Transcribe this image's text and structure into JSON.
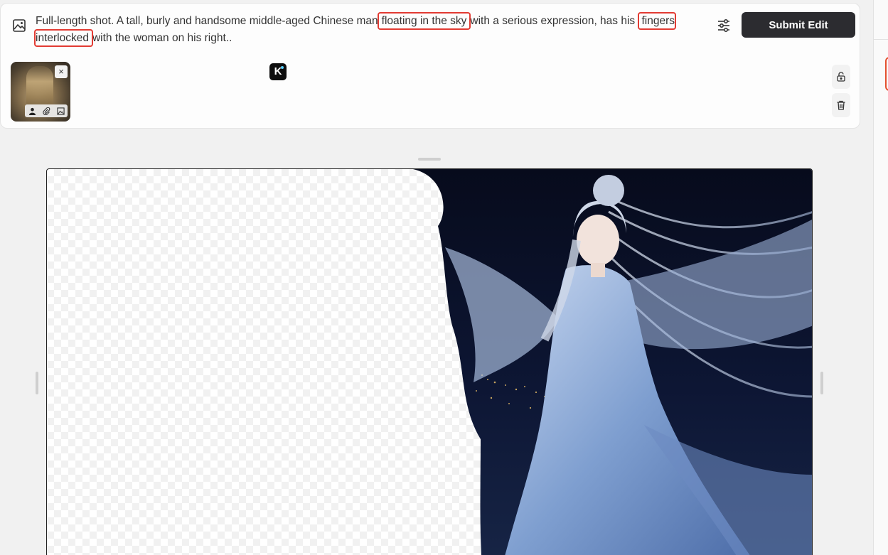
{
  "prompt": {
    "part1": "Full-length shot. A tall, burly and handsome middle-aged Chinese man",
    "highlight1": "floating in the sky",
    "part2": "with a serious expression, has his",
    "highlight2": "fingers interlocked",
    "part3": "with the woman on his right.."
  },
  "toolbar": {
    "submit_label": "Submit Edit",
    "logo_letter": "K"
  },
  "thumbnail": {
    "close_glyph": "×"
  },
  "icons": {
    "image_mode": "image-icon",
    "settings": "sliders-icon",
    "person": "person-icon",
    "attach": "paperclip-icon",
    "image": "image-icon",
    "lock": "unlock-icon",
    "trash": "trash-icon"
  },
  "colors": {
    "highlight_border": "#e23b33",
    "submit_bg": "#2c2c30",
    "rail_selected": "#e4502e"
  }
}
